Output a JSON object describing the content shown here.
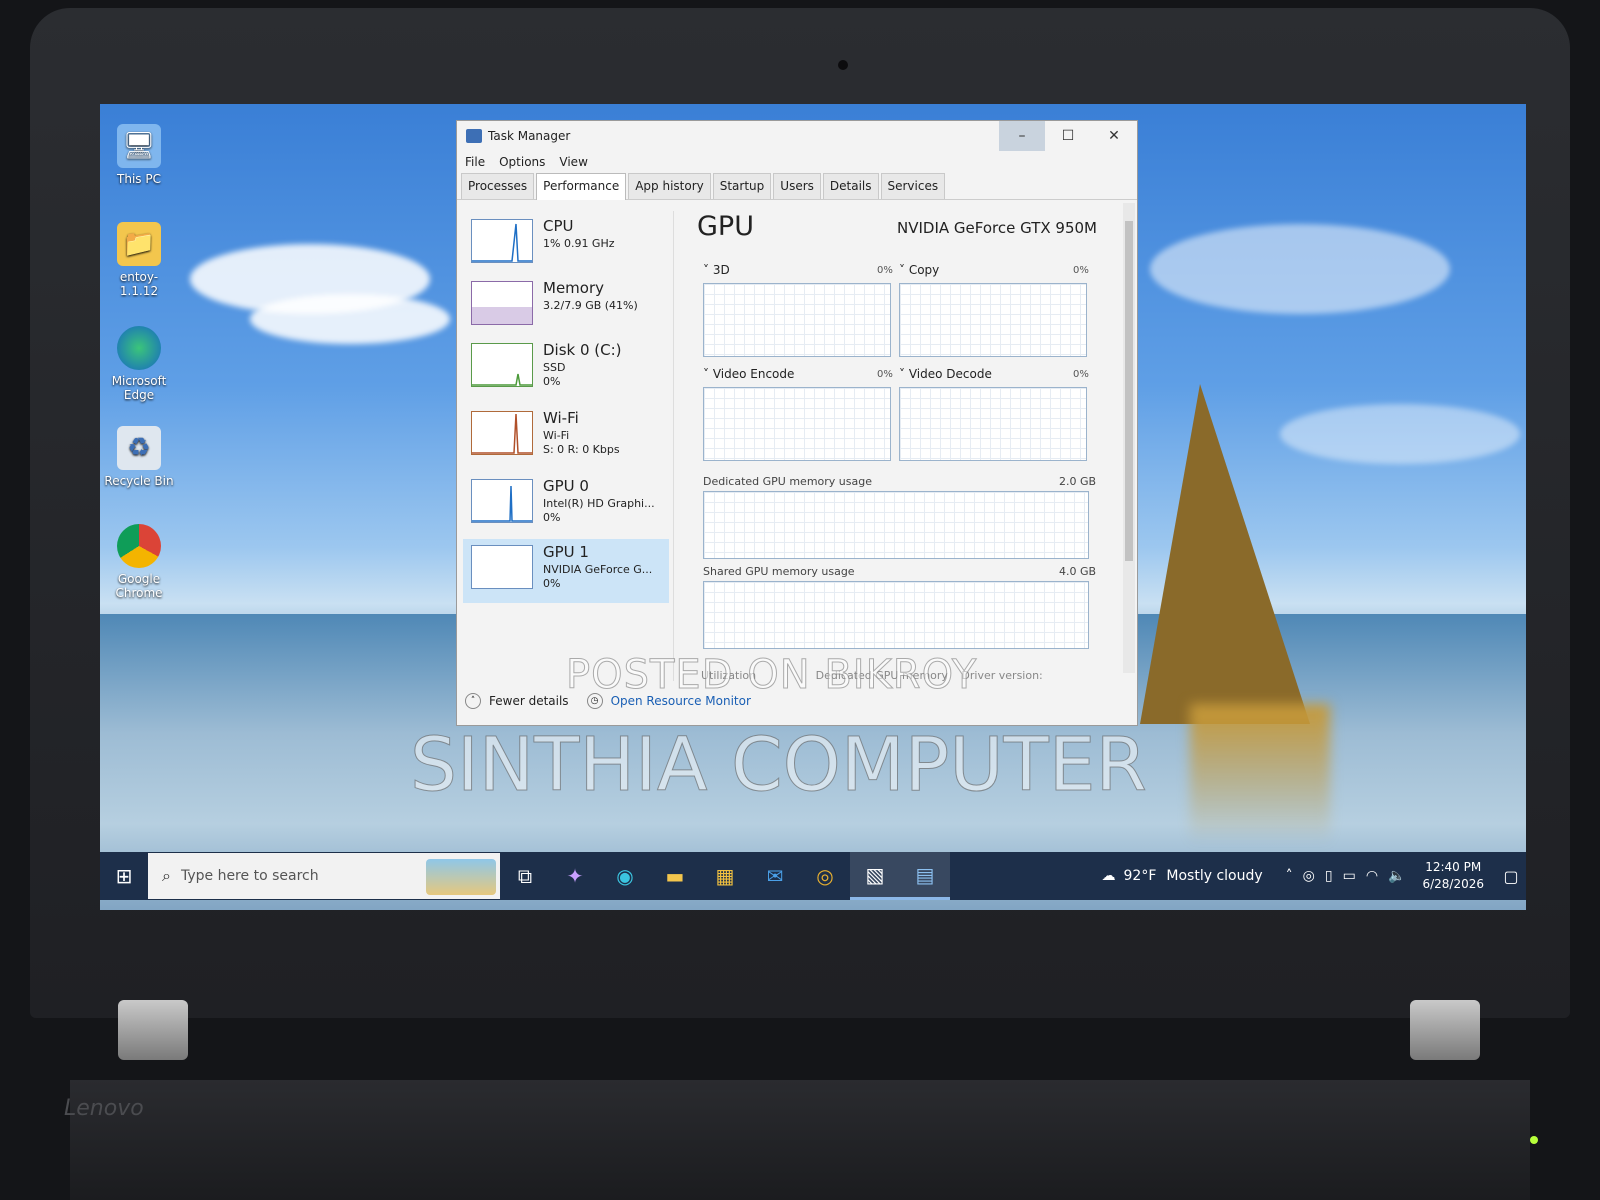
{
  "desktop": {
    "icons": [
      {
        "label": "This PC",
        "icon": "computer-icon"
      },
      {
        "label": "entoy-1.1.12",
        "icon": "folder-icon"
      },
      {
        "label": "Microsoft Edge",
        "icon": "edge-icon"
      },
      {
        "label": "Recycle Bin",
        "icon": "recycle-bin-icon"
      },
      {
        "label": "Google Chrome",
        "icon": "chrome-icon"
      }
    ]
  },
  "window": {
    "title": "Task Manager",
    "menu": [
      "File",
      "Options",
      "View"
    ],
    "tabs": [
      "Processes",
      "Performance",
      "App history",
      "Startup",
      "Users",
      "Details",
      "Services"
    ],
    "active_tab": "Performance"
  },
  "resources": [
    {
      "name": "CPU",
      "line1": "1% 0.91 GHz",
      "line2": ""
    },
    {
      "name": "Memory",
      "line1": "3.2/7.9 GB (41%)",
      "line2": ""
    },
    {
      "name": "Disk 0 (C:)",
      "line1": "SSD",
      "line2": "0%"
    },
    {
      "name": "Wi-Fi",
      "line1": "Wi-Fi",
      "line2": "S: 0 R: 0 Kbps"
    },
    {
      "name": "GPU 0",
      "line1": "Intel(R) HD Graphi...",
      "line2": "0%"
    },
    {
      "name": "GPU 1",
      "line1": "NVIDIA GeForce G...",
      "line2": "0%"
    }
  ],
  "gpu": {
    "title": "GPU",
    "model": "NVIDIA GeForce GTX 950M",
    "engines": [
      {
        "label": "3D",
        "pct": "0%"
      },
      {
        "label": "Copy",
        "pct": "0%"
      },
      {
        "label": "Video Encode",
        "pct": "0%"
      },
      {
        "label": "Video Decode",
        "pct": "0%"
      }
    ],
    "dedicated_label": "Dedicated GPU memory usage",
    "dedicated_max": "2.0 GB",
    "shared_label": "Shared GPU memory usage",
    "shared_max": "4.0 GB",
    "stat_utilization": "Utilization",
    "stat_dedicated": "Dedicated GPU memory",
    "stat_driver": "Driver version:"
  },
  "footer": {
    "fewer_details": "Fewer details",
    "open_resource_monitor": "Open Resource Monitor"
  },
  "watermark": {
    "line1": "POSTED ON BIKROY",
    "line2": "SINTHIA COMPUTER"
  },
  "taskbar": {
    "search_placeholder": "Type here to search",
    "weather_temp": "92°F",
    "weather_desc": "Mostly cloudy",
    "time": "12:40 PM",
    "date": "6/28/2026"
  },
  "hardware": {
    "brand": "Lenovo"
  },
  "colors": {
    "accent": "#1a5fb4",
    "selection": "#cce4f7",
    "taskbar": "#1d2f4a"
  }
}
